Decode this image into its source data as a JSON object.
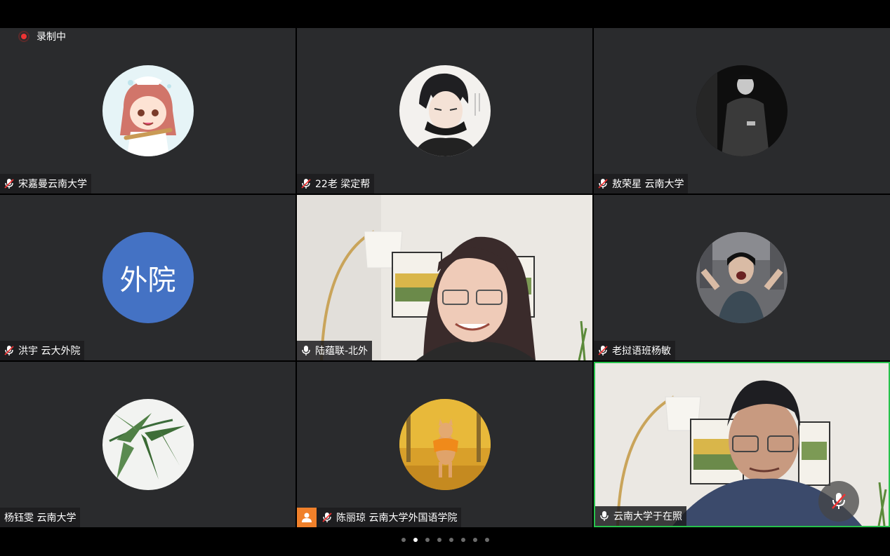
{
  "recording": {
    "label": "录制中"
  },
  "participants": [
    {
      "name": "宋嘉曼云南大学",
      "mic": "muted"
    },
    {
      "name": "22老 梁定帮",
      "mic": "muted"
    },
    {
      "name": "敖荣星 云南大学",
      "mic": "muted"
    },
    {
      "name": "洪宇 云大外院",
      "mic": "muted",
      "initials": "外院"
    },
    {
      "name": "陆蕴联-北外",
      "mic": "on"
    },
    {
      "name": "老挝语班杨敏",
      "mic": "muted"
    },
    {
      "name": "杨钰雯 云南大学",
      "mic": "none"
    },
    {
      "name": "陈丽琼 云南大学外国语学院",
      "mic": "muted",
      "host": true
    },
    {
      "name": "云南大学于在照",
      "mic": "on",
      "active_speaker": true
    }
  ],
  "pager": {
    "pages": 8,
    "current": 2
  },
  "colors": {
    "active_border": "#27c24c",
    "tile_bg": "#2a2b2d",
    "initials_bg": "#4472c4",
    "host_badge": "#f0802a",
    "record_dot": "#ee3333"
  }
}
